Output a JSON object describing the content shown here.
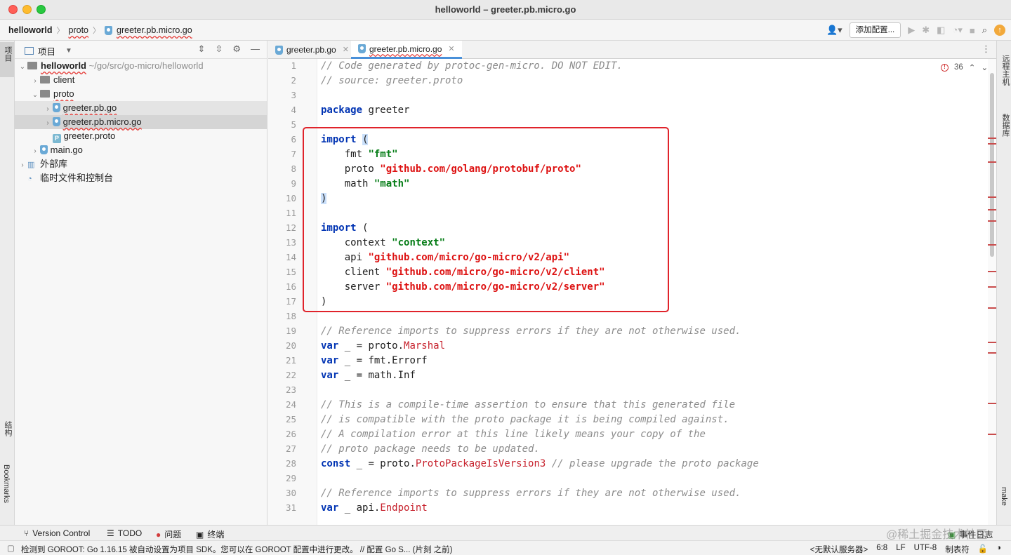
{
  "window": {
    "title": "helloworld – greeter.pb.micro.go"
  },
  "breadcrumb": {
    "project": "helloworld",
    "folder": "proto",
    "file": "greeter.pb.micro.go"
  },
  "toolbar": {
    "add_config_label": "添加配置..."
  },
  "left_strip": {
    "project_label": "项目",
    "structure_label": "结构",
    "bookmarks_label": "Bookmarks"
  },
  "right_strip": {
    "remote_label": "远程主机",
    "database_label": "数据库",
    "make_label": "make"
  },
  "project_panel": {
    "title": "项目",
    "tree": [
      {
        "label": "helloworld",
        "path": "~/go/src/go-micro/helloworld"
      },
      {
        "label": "client"
      },
      {
        "label": "proto"
      },
      {
        "label": "greeter.pb.go"
      },
      {
        "label": "greeter.pb.micro.go"
      },
      {
        "label": "greeter.proto"
      },
      {
        "label": "main.go"
      },
      {
        "label": "外部库"
      },
      {
        "label": "临时文件和控制台"
      }
    ]
  },
  "tabs": [
    {
      "label": "greeter.pb.go"
    },
    {
      "label": "greeter.pb.micro.go"
    }
  ],
  "editor": {
    "error_count": "36",
    "line_numbers": [
      "1",
      "2",
      "3",
      "4",
      "5",
      "6",
      "7",
      "8",
      "9",
      "10",
      "11",
      "12",
      "13",
      "14",
      "15",
      "16",
      "17",
      "18",
      "19",
      "20",
      "21",
      "22",
      "23",
      "24",
      "25",
      "26",
      "27",
      "28",
      "29",
      "30",
      "31"
    ],
    "lines": {
      "l1": "// Code generated by protoc-gen-micro. DO NOT EDIT.",
      "l2": "// source: greeter.proto",
      "l4_kw": "package",
      "l4_rest": " greeter",
      "l6_kw": "import",
      "l6_brk": "(",
      "l7_id": "    fmt ",
      "l7_str": "\"fmt\"",
      "l8_id": "    proto ",
      "l8_str": "\"github.com/golang/protobuf/proto\"",
      "l9_id": "    math ",
      "l9_str": "\"math\"",
      "l10_brk": ")",
      "l12_kw": "import",
      "l12_rest": " (",
      "l13_id": "    context ",
      "l13_str": "\"context\"",
      "l14_id": "    api ",
      "l14_str": "\"github.com/micro/go-micro/v2/api\"",
      "l15_id": "    client ",
      "l15_str": "\"github.com/micro/go-micro/v2/client\"",
      "l16_id": "    server ",
      "l16_str": "\"github.com/micro/go-micro/v2/server\"",
      "l17": ")",
      "l19": "// Reference imports to suppress errors if they are not otherwise used.",
      "l20_kw": "var",
      "l20_rest": " _ = proto.",
      "l20_fn": "Marshal",
      "l21_kw": "var",
      "l21_rest": " _ = fmt.Errorf",
      "l22_kw": "var",
      "l22_rest": " _ = math.Inf",
      "l24": "// This is a compile-time assertion to ensure that this generated file",
      "l25": "// is compatible with the proto package it is being compiled against.",
      "l26": "// A compilation error at this line likely means your copy of the",
      "l27": "// proto package needs to be updated.",
      "l28_kw": "const",
      "l28_rest": " _ = proto.",
      "l28_fn": "ProtoPackageIsVersion3",
      "l28_cmt": " // please upgrade the proto package",
      "l30": "// Reference imports to suppress errors if they are not otherwise used.",
      "l31_kw": "var",
      "l31_rest": " _ api.",
      "l31_fn": "Endpoint"
    }
  },
  "bottom_tools": {
    "vcs": "Version Control",
    "todo": "TODO",
    "problems": "问题",
    "terminal": "终端",
    "event_log": "事件日志"
  },
  "statusbar": {
    "message": "检测到 GOROOT: Go 1.16.15 被自动设置为项目 SDK。您可以在 GOROOT 配置中进行更改。 // 配置 Go S... (片刻 之前)",
    "server": "<无默认服务器>",
    "position": "6:8",
    "line_sep": "LF",
    "encoding": "UTF-8",
    "indent": "制表符"
  },
  "watermark": "@稀土掘金技术社区",
  "colors": {
    "highlight_box": "#e0232b",
    "keyword": "#0033b3",
    "string": "#067d17",
    "import_path": "#dd1111"
  }
}
